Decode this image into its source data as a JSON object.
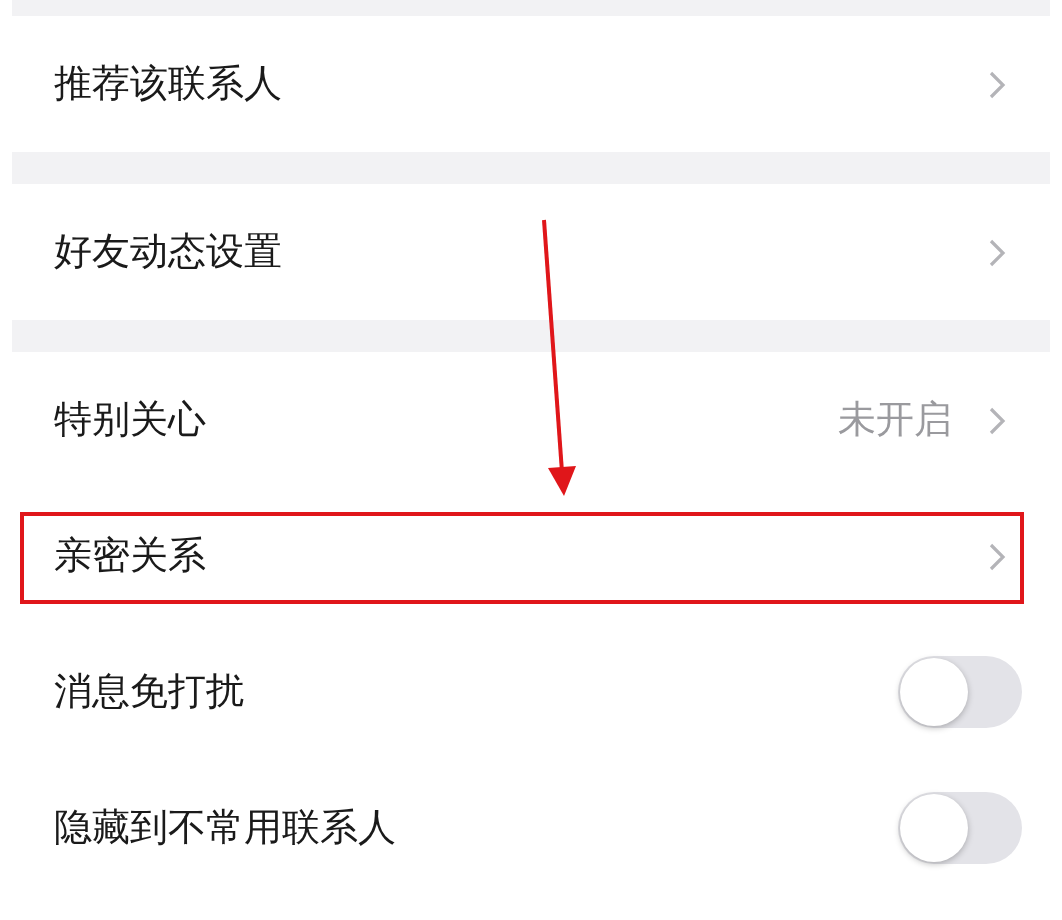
{
  "groups": [
    {
      "rows": [
        {
          "kind": "link",
          "label": "推荐该联系人",
          "highlighted": false
        }
      ]
    },
    {
      "rows": [
        {
          "kind": "link",
          "label": "好友动态设置",
          "highlighted": false
        }
      ]
    },
    {
      "rows": [
        {
          "kind": "value",
          "label": "特别关心",
          "value": "未开启",
          "highlighted": false
        },
        {
          "kind": "link",
          "label": "亲密关系",
          "highlighted": true
        },
        {
          "kind": "toggle",
          "label": "消息免打扰",
          "on": false,
          "highlighted": false
        },
        {
          "kind": "toggle",
          "label": "隐藏到不常用联系人",
          "on": false,
          "highlighted": false
        }
      ]
    }
  ]
}
